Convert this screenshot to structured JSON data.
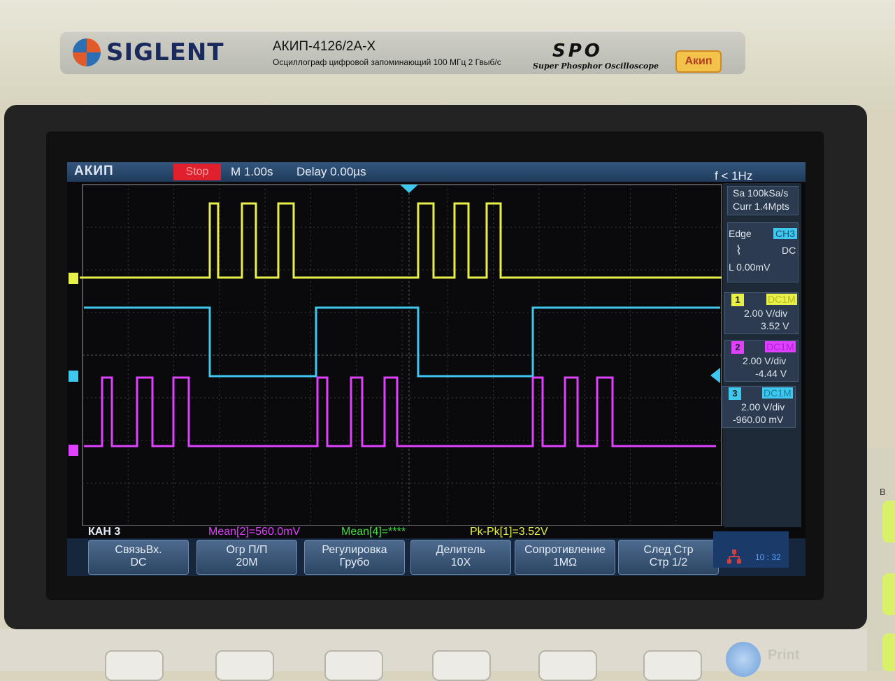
{
  "device": {
    "brand": "SIGLENT",
    "model": "АКИП-4126/2А-Х",
    "description": "Осциллограф цифровой запоминающий  100 МГц  2 Гвыб/с",
    "series": "SPO",
    "series_full": "Super Phosphor Oscilloscope",
    "badge": "Акип"
  },
  "topbar": {
    "logo": "АКИП",
    "run_state": "Stop",
    "timebase": "M 1.00s",
    "delay": "Delay 0.00µs",
    "frequency": "f < 1Hz"
  },
  "acquisition": {
    "sample_rate": "Sa 100kSa/s",
    "memory": "Curr 1.4Mpts"
  },
  "trigger": {
    "type": "Edge",
    "source": "CH3",
    "coupling": "DC",
    "level": "L  0.00mV"
  },
  "channels": [
    {
      "num": "1",
      "coupling": "DC1M",
      "vdiv": "2.00 V/div",
      "offset": "3.52 V",
      "color": "#e8f04a"
    },
    {
      "num": "2",
      "coupling": "DC1M",
      "vdiv": "2.00 V/div",
      "offset": "-4.44 V",
      "color": "#e040ff"
    },
    {
      "num": "3",
      "coupling": "DC1M",
      "vdiv": "2.00 V/div",
      "offset": "-960.00 mV",
      "color": "#3ec8f0"
    }
  ],
  "status": {
    "menu_channel": "КАН 3",
    "meas1": "Mean[2]=560.0mV",
    "meas2": "Mean[4]=****",
    "meas3": "Pk-Pk[1]=3.52V"
  },
  "menu": [
    {
      "line1": "СвязьВх.",
      "line2": "DC"
    },
    {
      "line1": "Огр  П/П",
      "line2": "20M"
    },
    {
      "line1": "Регулировка",
      "line2": "Грубо"
    },
    {
      "line1": "Делитель",
      "line2": "10X"
    },
    {
      "line1": "Сопротивление",
      "line2": "1MΩ"
    },
    {
      "line1": "След  Стр",
      "line2": "Стр 1/2"
    }
  ],
  "clock": "10 : 32",
  "panel": {
    "print_label": "Print",
    "b_label": "B"
  },
  "waveforms": {
    "ch1_pulses_ms": [
      [
        300,
        312
      ],
      [
        346,
        366
      ],
      [
        398,
        420
      ],
      [
        598,
        620
      ],
      [
        650,
        670
      ],
      [
        696,
        716
      ]
    ],
    "ch3_edges": [
      300,
      452,
      598,
      762
    ],
    "ch2_pulses": [
      [
        146,
        160
      ],
      [
        196,
        218
      ],
      [
        248,
        270
      ],
      [
        454,
        468
      ],
      [
        502,
        518
      ],
      [
        550,
        568
      ],
      [
        762,
        776
      ],
      [
        808,
        826
      ],
      [
        854,
        876
      ]
    ]
  }
}
